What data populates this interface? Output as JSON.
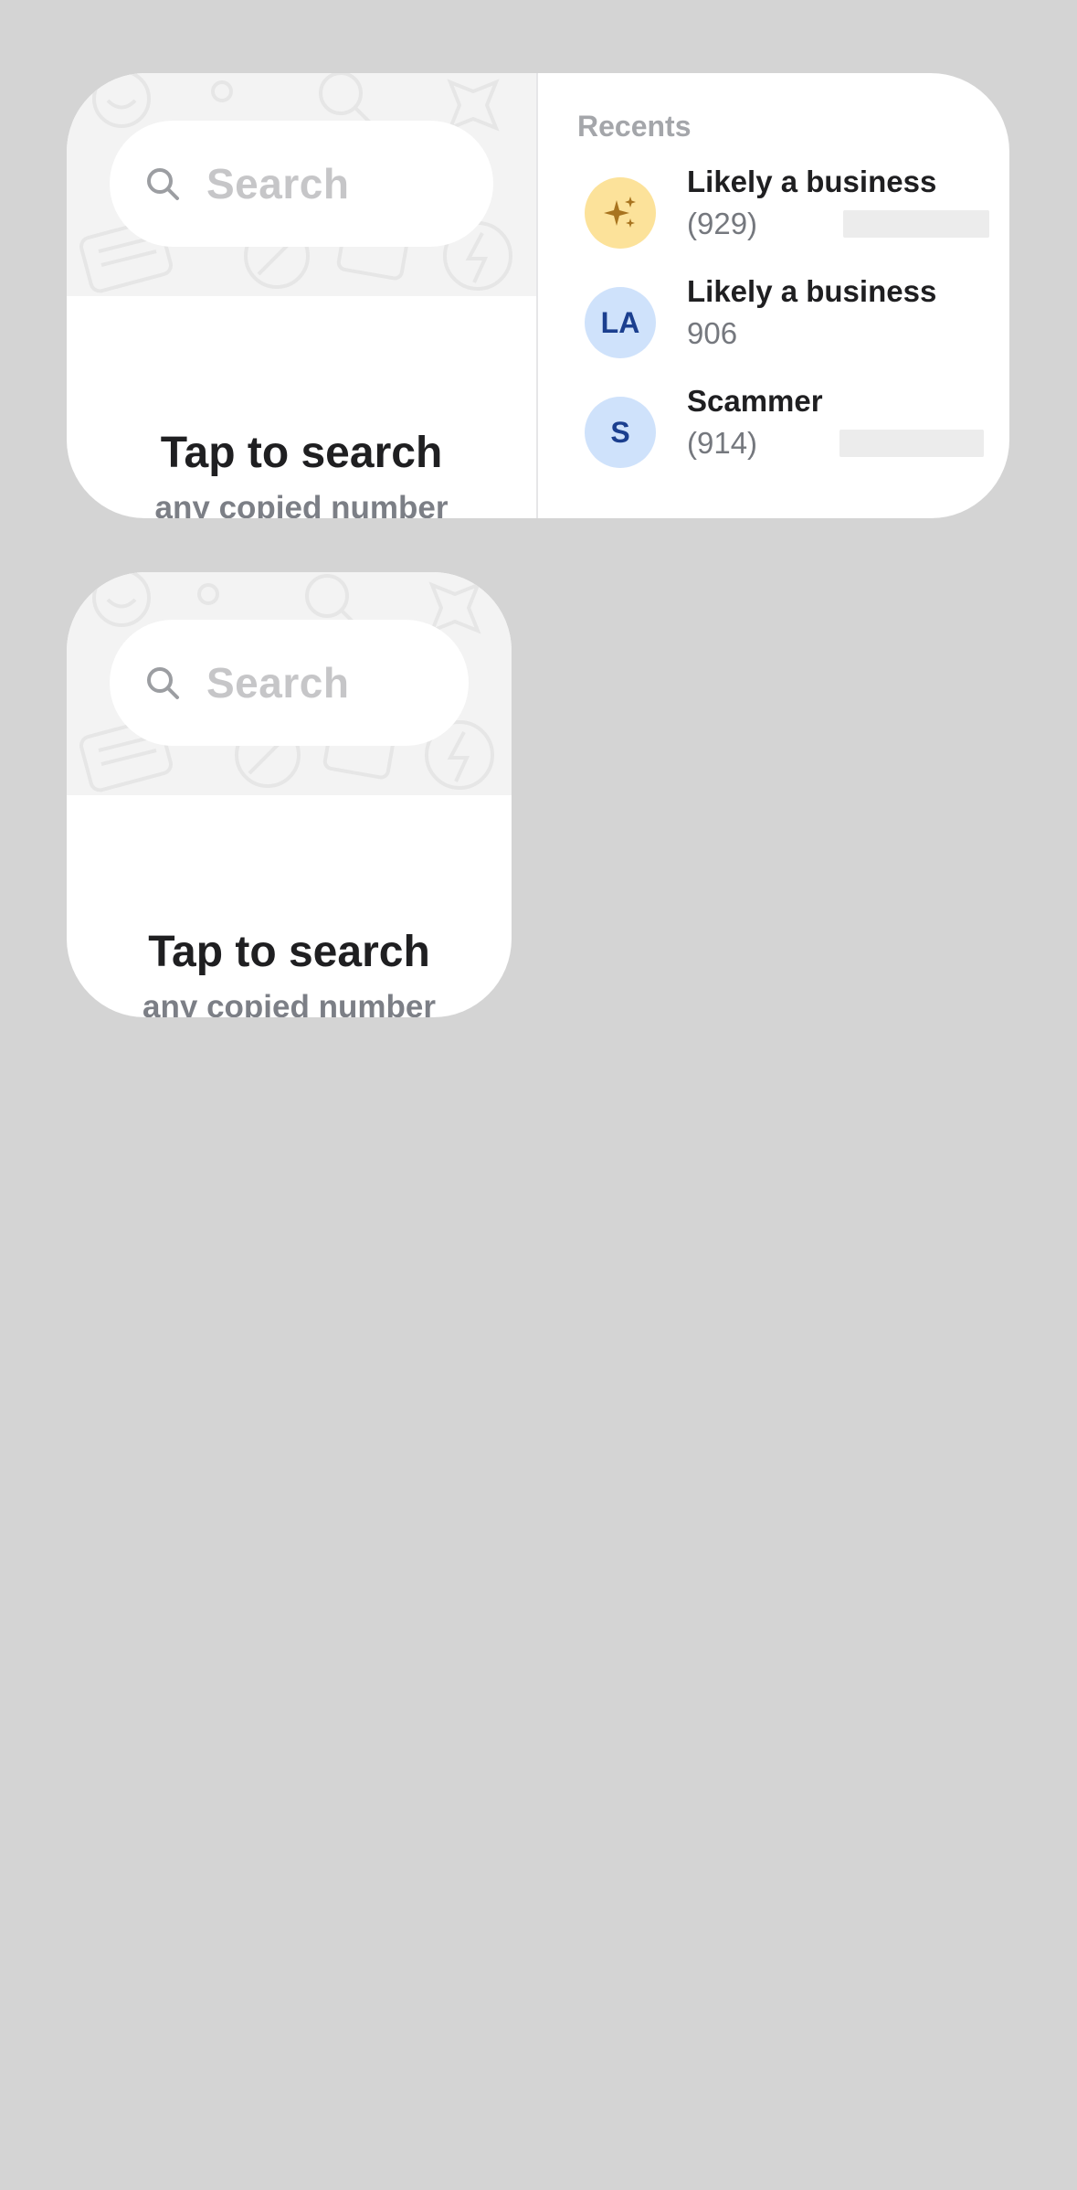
{
  "widgets": {
    "wide": {
      "search_placeholder": "Search",
      "cta_title": "Tap to search",
      "cta_subtitle": "any copied number",
      "recents_title": "Recents",
      "recents": [
        {
          "name": "Likely a business",
          "number": "(929)",
          "avatar": "sparkle-icon",
          "avatar_text": "",
          "redacted": true
        },
        {
          "name": "Likely a business",
          "number": "906",
          "avatar": "initials",
          "avatar_text": "LA",
          "redacted": false
        },
        {
          "name": "Scammer",
          "number": "(914)",
          "avatar": "initials",
          "avatar_text": "S",
          "redacted": true
        }
      ]
    },
    "small": {
      "search_placeholder": "Search",
      "cta_title": "Tap to search",
      "cta_subtitle": "any copied number"
    }
  },
  "colors": {
    "background": "#d4d4d4",
    "card": "#ffffff",
    "pattern": "#f3f3f3",
    "avatar_gold": "#fce29a",
    "avatar_blue": "#cfe2fb",
    "avatar_text": "#1b3f8f",
    "sparkle": "#a8741f"
  }
}
